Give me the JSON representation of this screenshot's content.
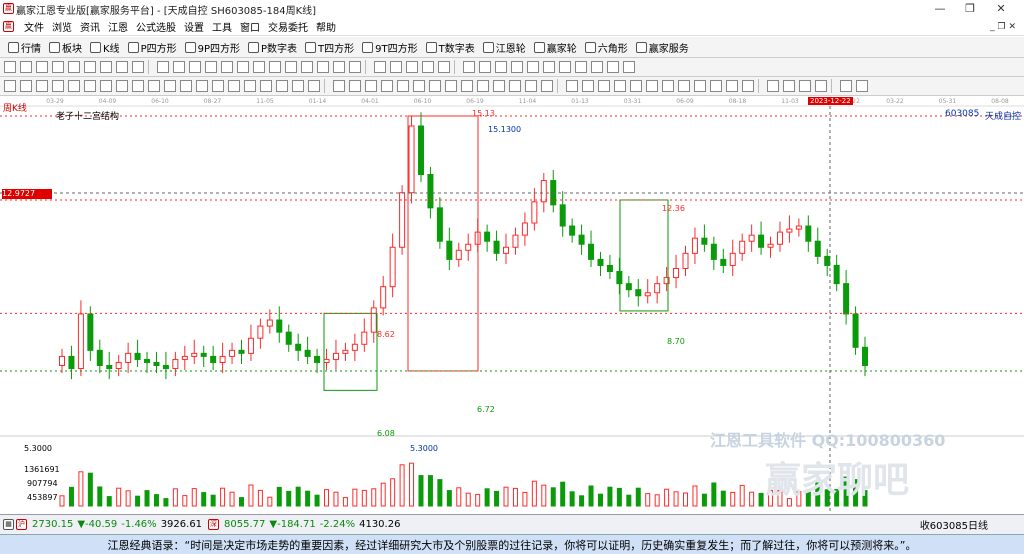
{
  "window": {
    "title": "赢家江恩专业版[赢家服务平台] - [天成自控  SH603085-184周K线]",
    "controls": [
      "—",
      "❐",
      "✕"
    ]
  },
  "menu": [
    "文件",
    "浏览",
    "资讯",
    "江恩",
    "公式选股",
    "设置",
    "工具",
    "窗口",
    "交易委托",
    "帮助"
  ],
  "toolbar_main": [
    {
      "icon": "grid-icon",
      "label": "行情"
    },
    {
      "icon": "blocks-icon",
      "label": "板块"
    },
    {
      "icon": "kline-icon",
      "label": "K线"
    },
    {
      "icon": "p4-icon",
      "label": "P四方形"
    },
    {
      "icon": "9p-icon",
      "label": "9P四方形"
    },
    {
      "icon": "pn-icon",
      "label": "P数字表"
    },
    {
      "icon": "t4-icon",
      "label": "T四方形"
    },
    {
      "icon": "9t-icon",
      "label": "9T四方形"
    },
    {
      "icon": "tn-icon",
      "label": "T数字表"
    },
    {
      "icon": "wheel-icon",
      "label": "江恩轮"
    },
    {
      "icon": "wheel2-icon",
      "label": "赢家轮"
    },
    {
      "icon": "star-icon",
      "label": "六角形"
    },
    {
      "icon": "dollar-icon",
      "label": "赢家服务"
    }
  ],
  "chart": {
    "period_label": "周K线",
    "indicator_name": "老子十二宫结构",
    "stock_code": "603085",
    "stock_name": "天成自控",
    "date_ticks": [
      "03-29",
      "04-09",
      "06-10",
      "08-27",
      "11-05",
      "01-14",
      "04-01",
      "06-10",
      "06-19",
      "11-04",
      "01-13",
      "03-31",
      "06-09",
      "08-18",
      "11-03",
      "2023-12-22",
      "03-22",
      "05-31",
      "08-08"
    ],
    "crosshair_price": "12.9727",
    "crosshair_date": "2023-12-22",
    "annotations": [
      "15.13",
      "15.1300",
      "12.36",
      "8.62",
      "8.70",
      "6.72",
      "6.08",
      "5.3000"
    ],
    "volume_axis": [
      "5.3000",
      "1361691",
      "907794",
      "453897"
    ]
  },
  "chart_data": {
    "type": "candlestick",
    "title": "老子十二宫结构",
    "xlabel": "",
    "ylabel": "",
    "ylim": [
      5.3,
      15.13
    ],
    "levels": [
      {
        "label": "15.13",
        "value": 15.13
      },
      {
        "label": "12.36",
        "value": 12.36
      },
      {
        "label": "8.62",
        "value": 8.62
      },
      {
        "label": "6.72",
        "value": 6.72
      }
    ],
    "close_series": [
      7.2,
      6.8,
      8.6,
      7.4,
      6.9,
      6.8,
      7.0,
      7.3,
      7.1,
      7.0,
      6.9,
      6.8,
      7.1,
      7.2,
      7.3,
      7.2,
      7.0,
      7.2,
      7.4,
      7.3,
      7.8,
      8.2,
      8.4,
      8.0,
      7.6,
      7.4,
      7.2,
      7.0,
      7.1,
      7.3,
      7.4,
      7.6,
      8.0,
      8.8,
      9.5,
      10.8,
      12.6,
      14.8,
      13.2,
      12.1,
      11.0,
      10.4,
      10.7,
      10.9,
      11.3,
      11.0,
      10.6,
      10.8,
      11.2,
      11.6,
      12.3,
      13.0,
      12.2,
      11.5,
      11.2,
      10.9,
      10.4,
      10.2,
      10.0,
      9.6,
      9.4,
      9.2,
      9.3,
      9.6,
      9.8,
      10.1,
      10.6,
      11.1,
      10.9,
      10.4,
      10.2,
      10.6,
      11.0,
      11.2,
      10.8,
      10.9,
      11.3,
      11.4,
      11.5,
      11.0,
      10.5,
      10.2,
      9.6,
      8.6,
      7.5,
      6.9
    ]
  },
  "status": {
    "index1_value": "2730.15",
    "index1_change": "▼-40.59",
    "index1_pct": "-1.46%",
    "index1_vol": "3926.61",
    "index2_value": "8055.77",
    "index2_change": "▼-184.71",
    "index2_pct": "-2.24%",
    "index2_vol": "4130.26",
    "right_info": "收603085日线"
  },
  "footer": {
    "quote": "江恩经典语录：“时间是决定市场走势的重要因素，经过详细研究大市及个别股票的过往记录，你将可以证明，历史确实重复发生；而了解过往，你将可以预测将来。”。"
  },
  "watermark": {
    "line1": "江恩工具软件  QQ:100800360",
    "line2": "赢家聊吧"
  },
  "colors": {
    "up": "#ff2a2a",
    "down": "#0a9a0a",
    "grid": "#dcdcdc",
    "crosshair": "#e00000"
  }
}
